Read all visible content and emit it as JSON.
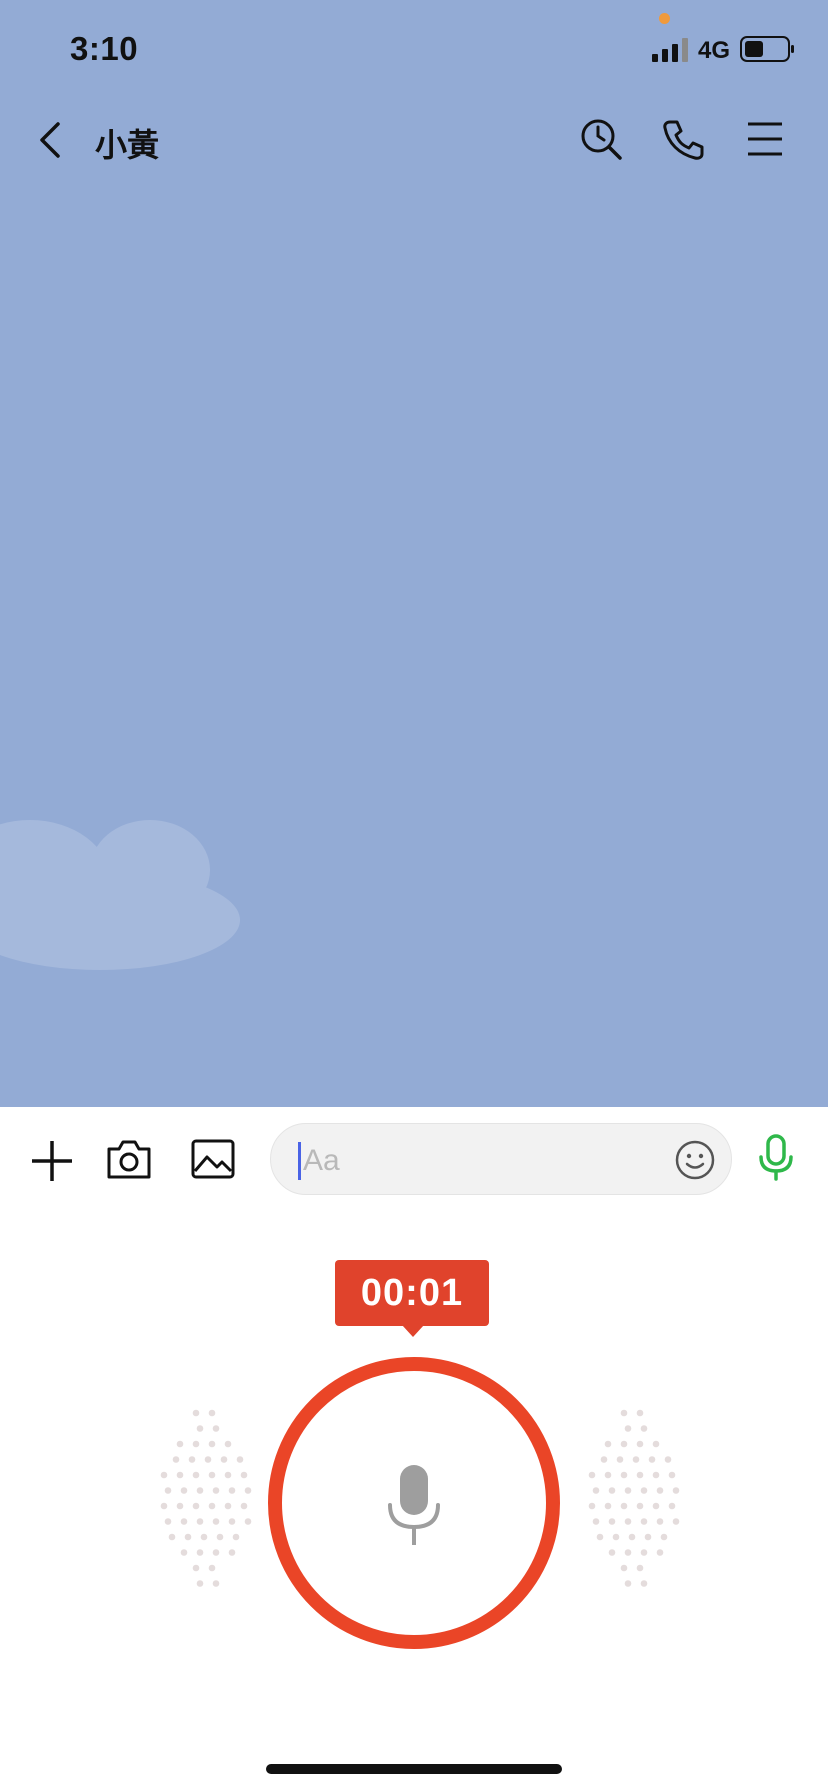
{
  "status_bar": {
    "time": "3:10",
    "network": "4G",
    "icons": [
      "signal-icon",
      "battery-icon"
    ]
  },
  "nav": {
    "title": "小黃",
    "icons": [
      "back-icon",
      "clock-search-icon",
      "phone-icon",
      "menu-icon"
    ]
  },
  "input_bar": {
    "placeholder": "Aa",
    "icons": [
      "plus-icon",
      "camera-icon",
      "image-icon",
      "emoji-icon",
      "mic-icon"
    ]
  },
  "recorder": {
    "timer": "00:01",
    "icons": [
      "mic-icon"
    ]
  },
  "colors": {
    "chat_background": "#93abd5",
    "record_accent": "#ea4527",
    "timer_badge": "#e0432c",
    "mic_green": "#2fb84a",
    "caret": "#4a63e6"
  }
}
